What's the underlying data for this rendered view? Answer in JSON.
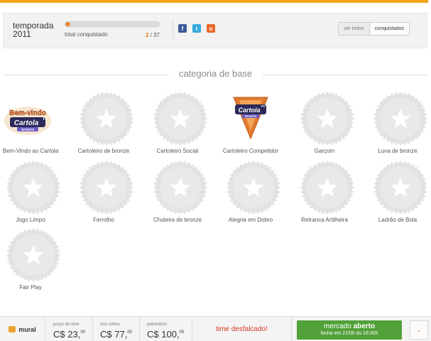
{
  "season": {
    "label": "temporada",
    "year": "2011"
  },
  "progress": {
    "label": "total conquistado",
    "current": "2",
    "total": "37",
    "fraction": 0.054
  },
  "share": [
    {
      "name": "facebook-icon",
      "glyph": "f"
    },
    {
      "name": "twitter-icon",
      "glyph": "t"
    },
    {
      "name": "orkut-icon",
      "glyph": "o"
    }
  ],
  "filters": {
    "all": "ver todos",
    "won": "conquistados"
  },
  "category": {
    "title": "categoria de base"
  },
  "badges": [
    {
      "label": "Bem-Vindo ao Cartola",
      "won": true
    },
    {
      "label": "Cartoleiro de bronze",
      "won": false
    },
    {
      "label": "Cartoleiro Social",
      "won": false
    },
    {
      "label": "Cartoleiro Competidor",
      "won": true
    },
    {
      "label": "Garçom",
      "won": false
    },
    {
      "label": "Luva de bronze",
      "won": false
    },
    {
      "label": "Jogo Limpo",
      "won": false
    },
    {
      "label": "Ferrolho",
      "won": false
    },
    {
      "label": "Chuteira de bronze",
      "won": false
    },
    {
      "label": "Alegria em Dobro",
      "won": false
    },
    {
      "label": "Retranca Artilheira",
      "won": false
    },
    {
      "label": "Ladrão de Bola",
      "won": false
    },
    {
      "label": "Fair Play",
      "won": false
    }
  ],
  "logos": {
    "welcome_line1": "Bem-vindo",
    "cartola": "Cartola",
    "fc": "FC",
    "sports": "SPORTS"
  },
  "bottom": {
    "mural": "mural",
    "price": {
      "caption": "preço do time",
      "value": "C$ 23,",
      "cents": "00"
    },
    "safe": {
      "caption": "nos cofres",
      "value": "C$ 77,",
      "cents": "00"
    },
    "assets": {
      "caption": "patrimônio",
      "value": "C$ 100,",
      "cents": "00"
    },
    "alert": "time desfalcado!",
    "market": {
      "prefix": "mercado",
      "status": "aberto",
      "closes": "fecha em 21/05 às 16:30h"
    },
    "expand_glyph": "⌄"
  },
  "colors": {
    "accent": "#f2a41c",
    "progress": "#e88a3b",
    "market_green": "#52a03a",
    "alert_red": "#d43a25",
    "medal_gray": "#e3e3e3"
  }
}
